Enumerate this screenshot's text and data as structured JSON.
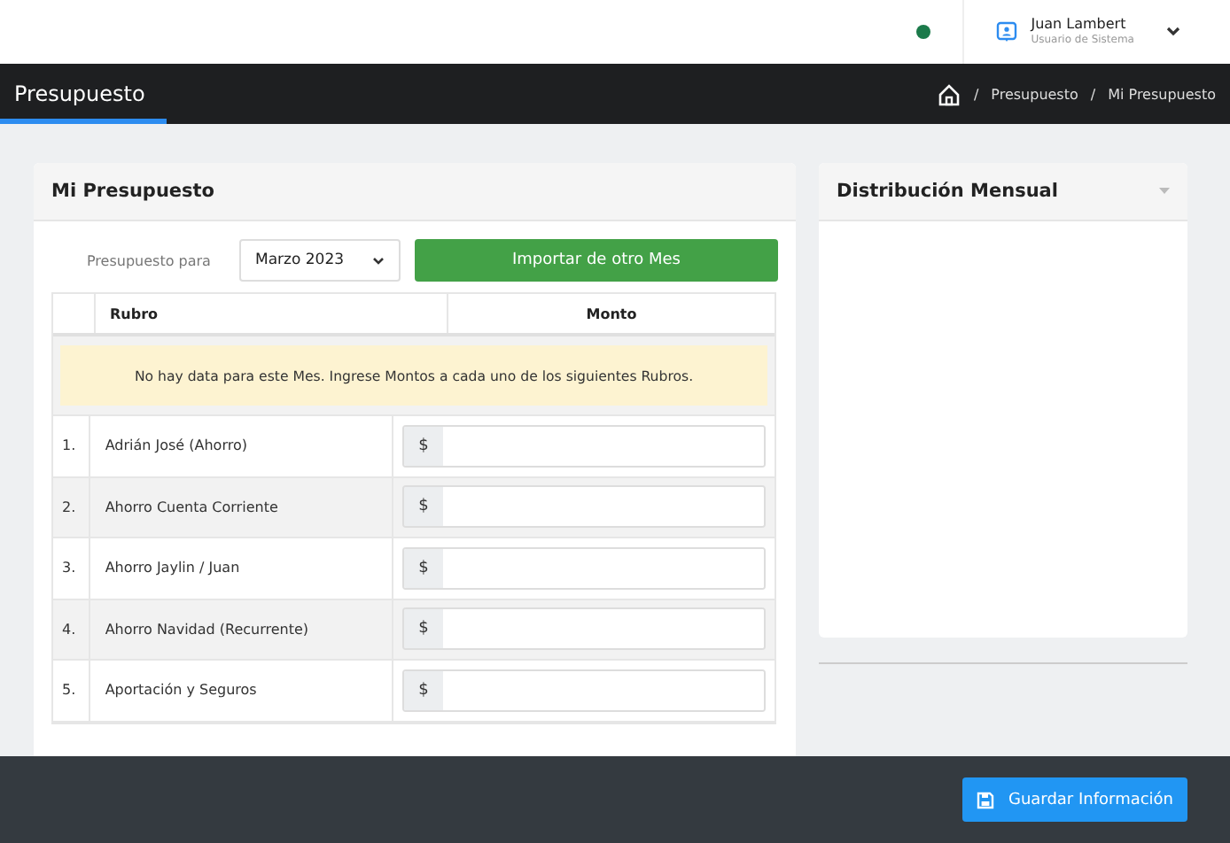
{
  "header": {
    "status_online": true,
    "user_name": "Juan Lambert",
    "user_role": "Usuario de Sistema"
  },
  "page_bar": {
    "title": "Presupuesto",
    "breadcrumbs": [
      {
        "separator": "/",
        "label": "Presupuesto"
      },
      {
        "separator": "/",
        "label": "Mi Presupuesto"
      }
    ]
  },
  "budget_card": {
    "title": "Mi Presupuesto",
    "period_label": "Presupuesto para",
    "period_value": "Marzo 2023",
    "import_button": "Importar de otro Mes",
    "columns": [
      "Rubro",
      "Monto"
    ],
    "notice": "No hay data para este Mes. Ingrese Montos a cada uno de los siguientes Rubros.",
    "rows": [
      {
        "number": "1.",
        "name": "Adrián José (Ahorro)",
        "currency": "$"
      },
      {
        "number": "2.",
        "name": "Ahorro Cuenta Corriente",
        "currency": "$"
      },
      {
        "number": "3.",
        "name": "Ahorro Jaylin / Juan",
        "currency": "$"
      },
      {
        "number": "4.",
        "name": "Ahorro Navidad (Recurrente)",
        "currency": "$"
      },
      {
        "number": "5.",
        "name": "Aportación y Seguros",
        "currency": "$"
      }
    ]
  },
  "distribution_card": {
    "title": "Distribución Mensual"
  },
  "footer": {
    "save_button": "Guardar Información"
  }
}
